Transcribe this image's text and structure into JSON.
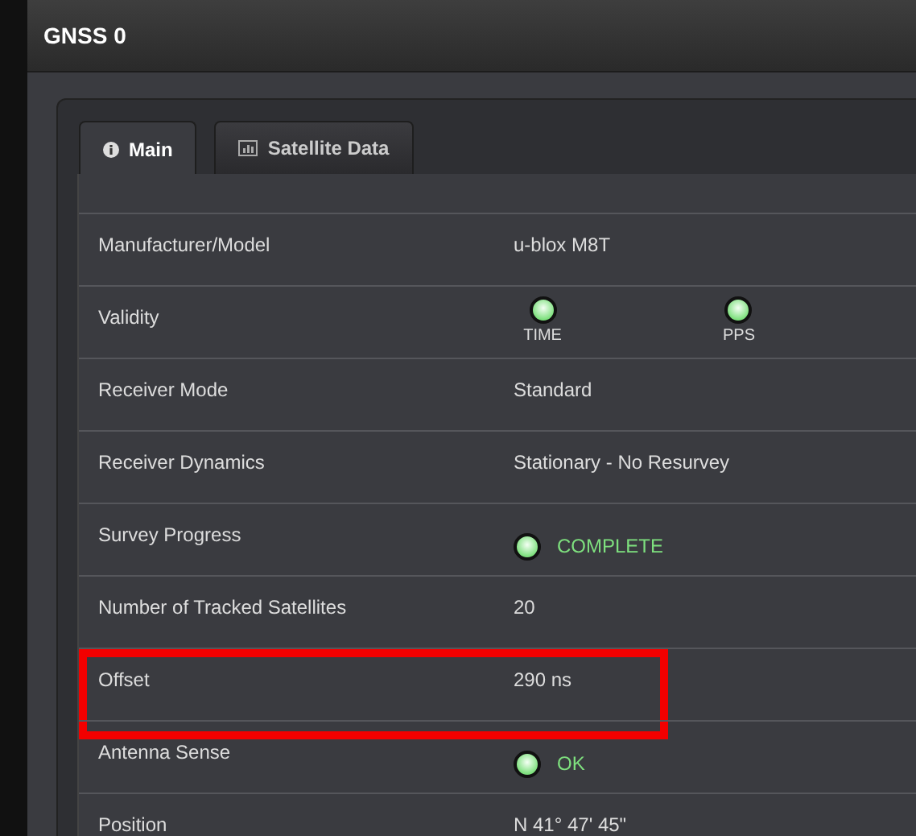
{
  "window": {
    "title": "GNSS 0"
  },
  "tabs": [
    {
      "label": "Main",
      "selected": true
    },
    {
      "label": "Satellite Data",
      "selected": false
    }
  ],
  "rows": [
    {
      "label": "Manufacturer/Model",
      "kind": "text",
      "value": "u-blox M8T",
      "highlighted": false
    },
    {
      "label": "Validity",
      "kind": "leds",
      "leds": [
        {
          "label": "TIME",
          "color": "#7ee07e"
        },
        {
          "label": "PPS",
          "color": "#7ee07e"
        }
      ],
      "highlighted": false
    },
    {
      "label": "Receiver Mode",
      "kind": "text",
      "value": "Standard",
      "highlighted": false
    },
    {
      "label": "Receiver Dynamics",
      "kind": "text",
      "value": "Stationary - No Resurvey",
      "highlighted": false
    },
    {
      "label": "Survey Progress",
      "kind": "status",
      "value": "COMPLETE",
      "color": "#7ee07e",
      "highlighted": false
    },
    {
      "label": "Number of Tracked Satellites",
      "kind": "text",
      "value": "20",
      "highlighted": false
    },
    {
      "label": "Offset",
      "kind": "text",
      "value": "290 ns",
      "highlighted": true
    },
    {
      "label": "Antenna Sense",
      "kind": "status",
      "value": "OK",
      "color": "#7ee07e",
      "highlighted": false
    },
    {
      "label": "Position",
      "kind": "text",
      "value": "N 41° 47' 45\"",
      "highlighted": false
    }
  ]
}
